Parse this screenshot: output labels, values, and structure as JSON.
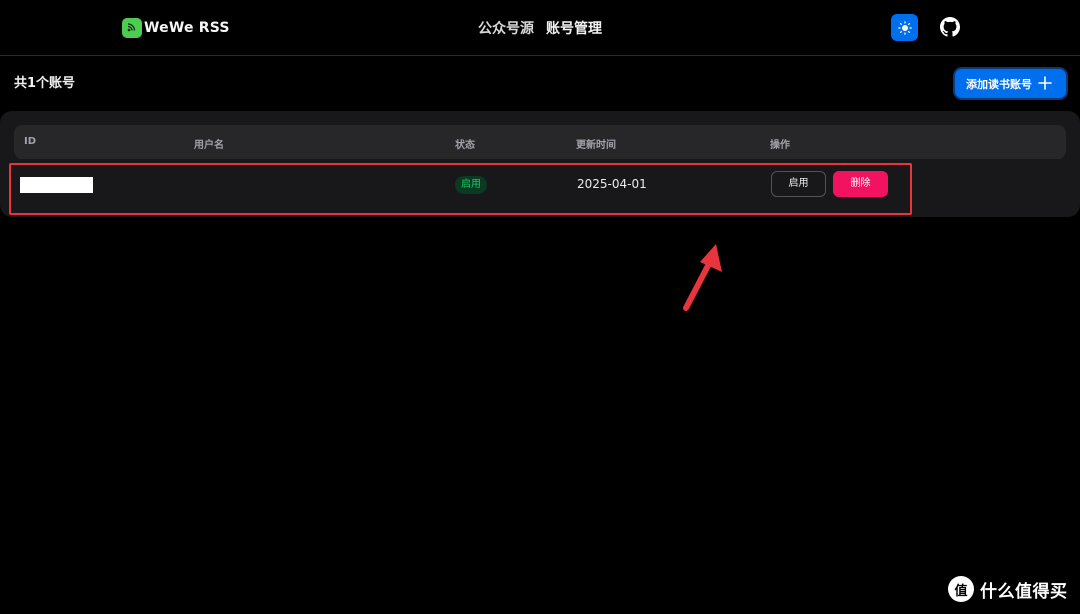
{
  "app": {
    "name": "WeWe RSS"
  },
  "nav": {
    "links": [
      {
        "label": "公众号源"
      },
      {
        "label": "账号管理"
      }
    ]
  },
  "icons": {
    "logo": "rss-chat-icon",
    "theme": "sun-icon",
    "github": "github-icon",
    "add": "plus-icon"
  },
  "colors": {
    "primary": "#006fee",
    "success": "#17c964",
    "danger": "#f31260",
    "annotation": "#e8343d"
  },
  "accounts": {
    "title": "共1个账号",
    "add_button_label": "添加读书账号",
    "columns": [
      "ID",
      "用户名",
      "状态",
      "更新时间",
      "操作"
    ],
    "rows": [
      {
        "id": "",
        "username": "",
        "status": "启用",
        "updated": "2025-04-01",
        "action_toggle": "启用",
        "action_delete": "删除"
      }
    ]
  },
  "watermark": {
    "text": "什么值得买",
    "logo": "值"
  }
}
